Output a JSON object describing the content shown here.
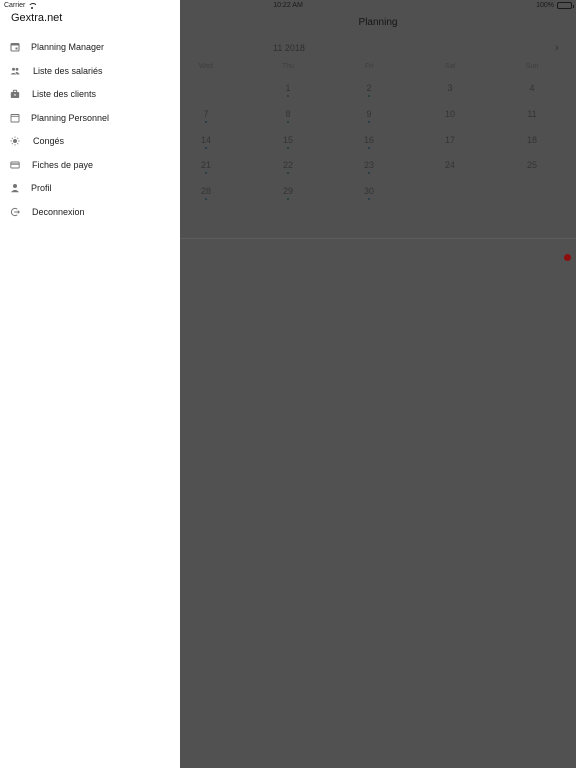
{
  "status_bar": {
    "carrier": "Carrier",
    "time": "10:22 AM",
    "battery": "100%",
    "battery_level": 1.0
  },
  "drawer": {
    "title": "Gextra.net",
    "items": [
      {
        "label": "Planning Manager",
        "icon": "calendar-icon"
      },
      {
        "label": "Liste des salariés",
        "icon": "people-icon"
      },
      {
        "label": "Liste des clients",
        "icon": "briefcase-icon"
      },
      {
        "label": "Planning Personnel",
        "icon": "calendar-outline-icon"
      },
      {
        "label": "Congés",
        "icon": "sun-icon"
      },
      {
        "label": "Fiches de paye",
        "icon": "credit-card-icon"
      },
      {
        "label": "Profil",
        "icon": "person-icon"
      },
      {
        "label": "Deconnexion",
        "icon": "logout-icon"
      }
    ]
  },
  "main": {
    "title": "Planning",
    "month": "11 2018",
    "weekdays": [
      "Wed",
      "Thu",
      "Fri",
      "Sat",
      "Sun"
    ],
    "weeks": [
      [
        "",
        "1",
        "2",
        "3",
        "4"
      ],
      [
        "7",
        "8",
        "9",
        "10",
        "11"
      ],
      [
        "14",
        "15",
        "16",
        "17",
        "18"
      ],
      [
        "21",
        "22",
        "23",
        "24",
        "25"
      ],
      [
        "28",
        "29",
        "30",
        "",
        ""
      ]
    ],
    "days_with_events": [
      "1",
      "2",
      "7",
      "8",
      "9",
      "14",
      "15",
      "16",
      "21",
      "22",
      "23",
      "28",
      "29",
      "30"
    ]
  },
  "colors": {
    "overlay": "#4e4e4e",
    "drawer_bg": "#ffffff",
    "event_dot": "#8e0d0d"
  }
}
